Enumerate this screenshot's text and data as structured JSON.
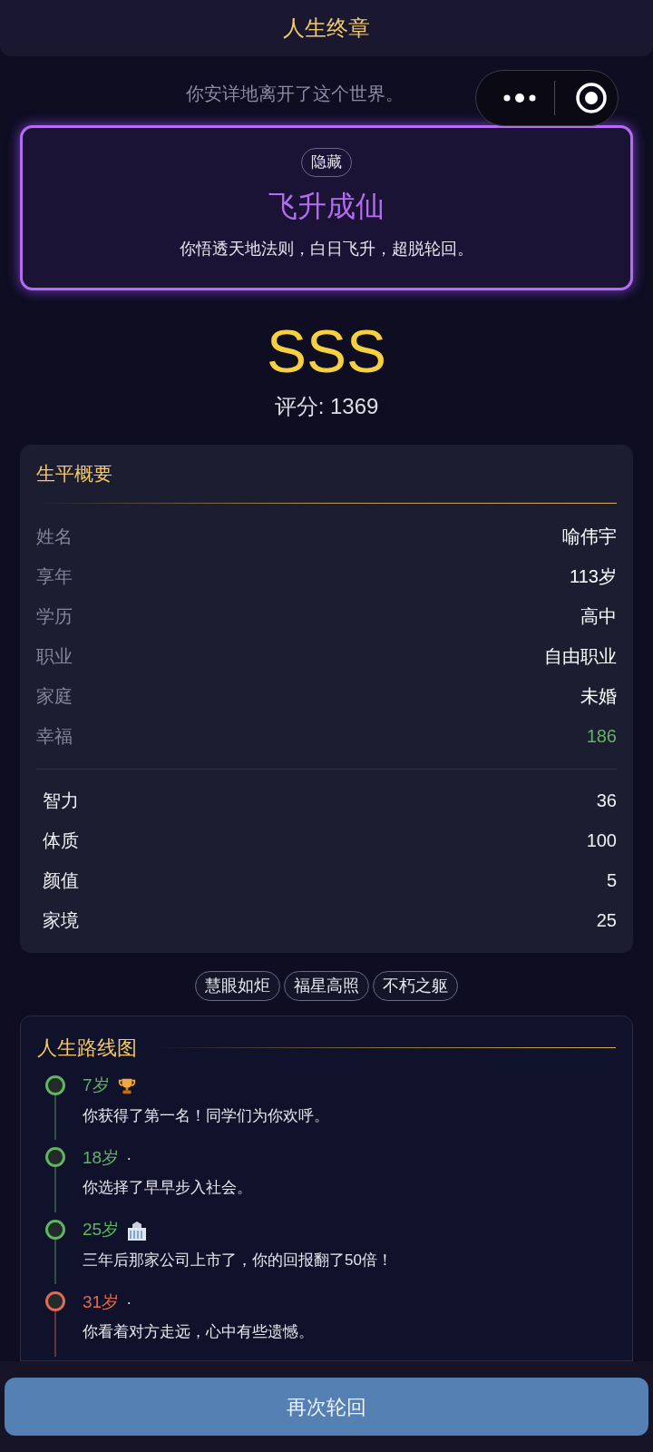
{
  "header": {
    "title": "人生终章"
  },
  "subtitle": "你安详地离开了这个世界。",
  "ending": {
    "badge": "隐藏",
    "title": "飞升成仙",
    "description": "你悟透天地法则，白日飞升，超脱轮回。"
  },
  "grade": "SSS",
  "score": "评分: 1369",
  "summary": {
    "title": "生平概要",
    "facts": [
      {
        "label": "姓名",
        "value": "喻伟宇",
        "color": "#ffffff"
      },
      {
        "label": "享年",
        "value": "113岁",
        "color": "#ffffff"
      },
      {
        "label": "学历",
        "value": "高中",
        "color": "#ffffff"
      },
      {
        "label": "职业",
        "value": "自由职业",
        "color": "#ffffff"
      },
      {
        "label": "家庭",
        "value": "未婚",
        "color": "#ffffff"
      },
      {
        "label": "幸福",
        "value": "186",
        "color": "#5fb562"
      }
    ],
    "attributes": [
      {
        "label": "智力",
        "value": "36"
      },
      {
        "label": "体质",
        "value": "100"
      },
      {
        "label": "颜值",
        "value": "5"
      },
      {
        "label": "家境",
        "value": "25"
      }
    ]
  },
  "talents": [
    "慧眼如炬",
    "福星高照",
    "不朽之躯"
  ],
  "roadmap": {
    "title": "人生路线图",
    "events": [
      {
        "age": "7岁",
        "kind": "trophy",
        "text": "你获得了第一名！同学们为你欢呼。",
        "color": "#5fb562"
      },
      {
        "age": "18岁",
        "kind": "dot",
        "marker": "·",
        "text": "你选择了早早步入社会。",
        "color": "#5fb562"
      },
      {
        "age": "25岁",
        "kind": "building",
        "text": "三年后那家公司上市了，你的回报翻了50倍！",
        "color": "#5fb562"
      },
      {
        "age": "31岁",
        "kind": "dot",
        "marker": "·",
        "text": "你看着对方走远，心中有些遗憾。",
        "color": "#e06a55"
      }
    ]
  },
  "button": "再次轮回"
}
